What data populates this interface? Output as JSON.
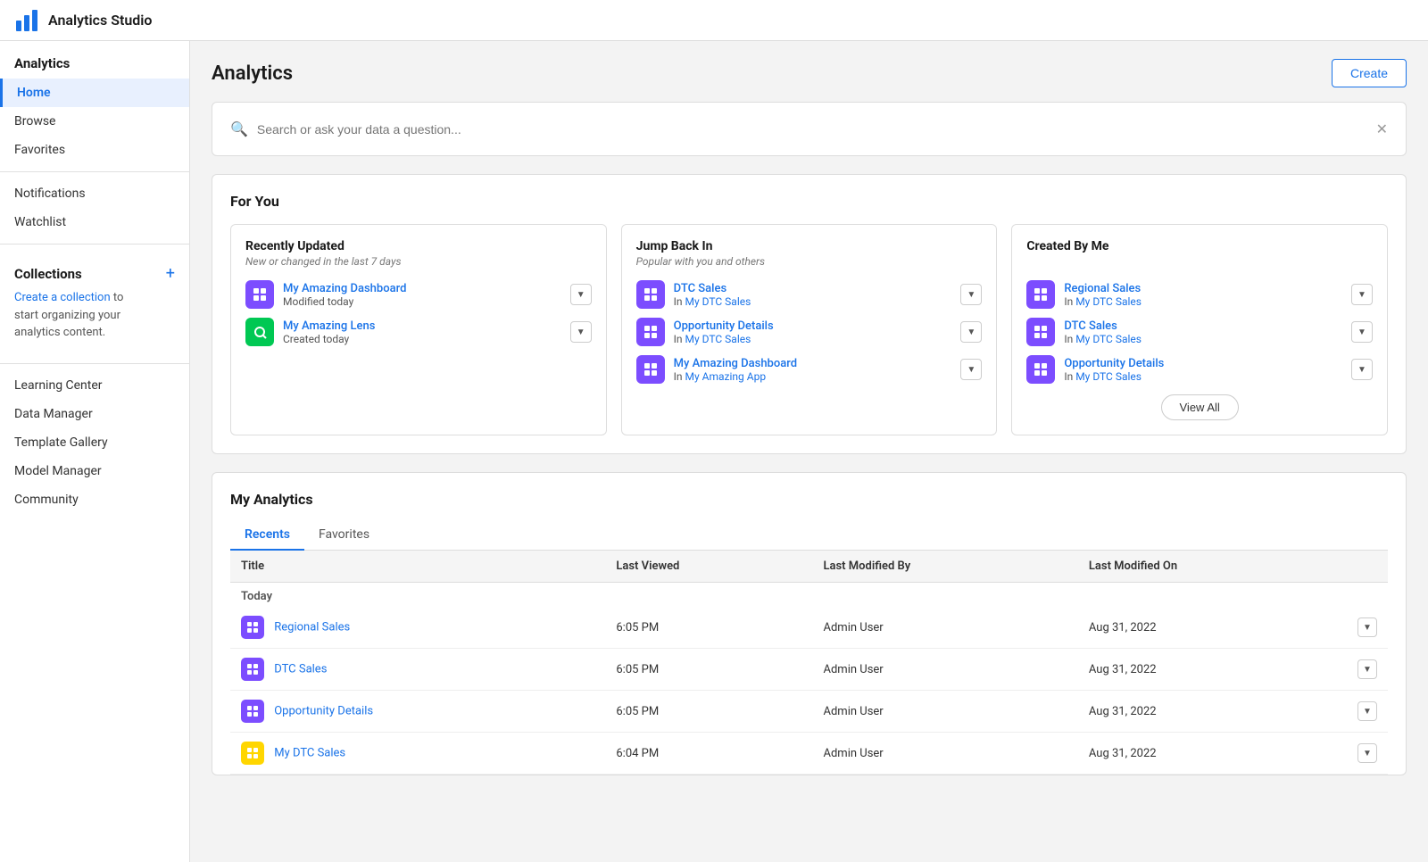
{
  "app": {
    "title": "Analytics Studio"
  },
  "sidebar": {
    "analytics_section": "Analytics",
    "nav_items": [
      {
        "id": "home",
        "label": "Home",
        "active": true
      },
      {
        "id": "browse",
        "label": "Browse",
        "active": false
      },
      {
        "id": "favorites",
        "label": "Favorites",
        "active": false
      }
    ],
    "secondary_items": [
      {
        "id": "notifications",
        "label": "Notifications"
      },
      {
        "id": "watchlist",
        "label": "Watchlist"
      }
    ],
    "collections_title": "Collections",
    "collections_plus": "+",
    "collections_text_link": "Create a collection",
    "collections_text_rest": " to\nstart organizing your\nanalytics content.",
    "tools_items": [
      {
        "id": "learning-center",
        "label": "Learning Center"
      },
      {
        "id": "data-manager",
        "label": "Data Manager"
      },
      {
        "id": "template-gallery",
        "label": "Template Gallery"
      },
      {
        "id": "model-manager",
        "label": "Model Manager"
      },
      {
        "id": "community",
        "label": "Community"
      }
    ]
  },
  "main": {
    "title": "Analytics",
    "create_button": "Create",
    "search": {
      "placeholder": "Search or ask your data a question..."
    },
    "for_you": {
      "section_title": "For You",
      "recently_updated": {
        "title": "Recently Updated",
        "subtitle": "New or changed in the last 7 days",
        "items": [
          {
            "id": "my-amazing-dashboard",
            "name": "My Amazing Dashboard",
            "meta": "Modified today",
            "icon_color": "purple",
            "icon_type": "dashboard"
          },
          {
            "id": "my-amazing-lens",
            "name": "My Amazing Lens",
            "meta": "Created today",
            "icon_color": "green",
            "icon_type": "lens"
          }
        ]
      },
      "jump_back_in": {
        "title": "Jump Back In",
        "subtitle": "Popular with you and others",
        "items": [
          {
            "id": "dtc-sales-1",
            "name": "DTC Sales",
            "meta_prefix": "In ",
            "meta_link": "My DTC Sales",
            "icon_color": "purple",
            "icon_type": "dashboard"
          },
          {
            "id": "opportunity-details-1",
            "name": "Opportunity Details",
            "meta_prefix": "In ",
            "meta_link": "My DTC Sales",
            "icon_color": "purple",
            "icon_type": "dashboard"
          },
          {
            "id": "my-amazing-dashboard-2",
            "name": "My Amazing Dashboard",
            "meta_prefix": "In ",
            "meta_link": "My Amazing App",
            "icon_color": "purple",
            "icon_type": "dashboard"
          }
        ]
      },
      "created_by_me": {
        "title": "Created By Me",
        "subtitle": "",
        "items": [
          {
            "id": "regional-sales-1",
            "name": "Regional Sales",
            "meta_prefix": "In ",
            "meta_link": "My DTC Sales",
            "icon_color": "purple",
            "icon_type": "dashboard"
          },
          {
            "id": "dtc-sales-2",
            "name": "DTC Sales",
            "meta_prefix": "In ",
            "meta_link": "My DTC Sales",
            "icon_color": "purple",
            "icon_type": "dashboard"
          },
          {
            "id": "opportunity-details-2",
            "name": "Opportunity Details",
            "meta_prefix": "In ",
            "meta_link": "My DTC Sales",
            "icon_color": "purple",
            "icon_type": "dashboard"
          }
        ],
        "view_all": "View All"
      }
    },
    "my_analytics": {
      "section_title": "My Analytics",
      "tabs": [
        {
          "id": "recents",
          "label": "Recents",
          "active": true
        },
        {
          "id": "favorites",
          "label": "Favorites",
          "active": false
        }
      ],
      "table": {
        "headers": [
          {
            "id": "title",
            "label": "Title"
          },
          {
            "id": "last_viewed",
            "label": "Last Viewed"
          },
          {
            "id": "last_modified_by",
            "label": "Last Modified By"
          },
          {
            "id": "last_modified_on",
            "label": "Last Modified On"
          }
        ],
        "groups": [
          {
            "group_label": "Today",
            "rows": [
              {
                "id": "regional-sales-t",
                "name": "Regional Sales",
                "last_viewed": "6:05 PM",
                "last_modified_by": "Admin User",
                "last_modified_on": "Aug 31, 2022",
                "icon_color": "purple",
                "icon_type": "dashboard"
              },
              {
                "id": "dtc-sales-t",
                "name": "DTC Sales",
                "last_viewed": "6:05 PM",
                "last_modified_by": "Admin User",
                "last_modified_on": "Aug 31, 2022",
                "icon_color": "purple",
                "icon_type": "dashboard"
              },
              {
                "id": "opportunity-details-t",
                "name": "Opportunity Details",
                "last_viewed": "6:05 PM",
                "last_modified_by": "Admin User",
                "last_modified_on": "Aug 31, 2022",
                "icon_color": "purple",
                "icon_type": "dashboard"
              },
              {
                "id": "my-dtc-sales-t",
                "name": "My DTC Sales",
                "last_viewed": "6:04 PM",
                "last_modified_by": "Admin User",
                "last_modified_on": "Aug 31, 2022",
                "icon_color": "yellow",
                "icon_type": "app"
              }
            ]
          }
        ]
      }
    }
  }
}
